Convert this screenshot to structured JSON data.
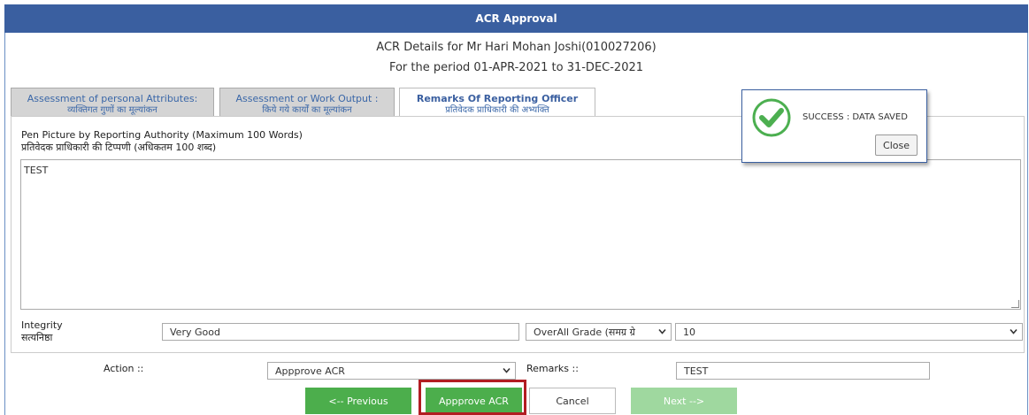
{
  "dialog_title": "ACR Approval",
  "header": {
    "line1": "ACR Details for Mr Hari Mohan Joshi(010027206)",
    "line2": "For the period 01-APR-2021 to 31-DEC-2021"
  },
  "tabs": [
    {
      "label": "Assessment of personal Attributes:",
      "sub": "व्यक्तिगत गुणों का मूल्यांकन",
      "active": false
    },
    {
      "label": "Assessment or Work Output :",
      "sub": "किये गये कार्यों का मूल्यांकन",
      "active": false
    },
    {
      "label": "Remarks Of Reporting Officer",
      "sub": "प्रतिवेदक प्राधिकारी की अभ्यक्ति",
      "active": true
    }
  ],
  "pen_picture": {
    "label_en": "Pen Picture by Reporting Authority (Maximum 100 Words)",
    "label_hi": "प्रतिवेदक प्राधिकारी की टिप्पणी (अधिकतम 100 शब्द)",
    "value": "TEST"
  },
  "integrity": {
    "label_en": "Integrity",
    "label_hi": "सत्यनिष्ठा",
    "value": "Very Good"
  },
  "overall_grade": {
    "select_value": "OverAll Grade (समग्र ग्रे",
    "grade_value": "10"
  },
  "action": {
    "label": "Action ::",
    "value": "Appprove ACR",
    "remarks_label": "Remarks ::",
    "remarks_value": "TEST"
  },
  "buttons": {
    "previous": "<-- Previous",
    "approve": "Appprove ACR",
    "cancel": "Cancel",
    "next": "Next -->"
  },
  "success_dialog": {
    "message": "SUCCESS : DATA SAVED",
    "close_label": "Close",
    "icon": "check-circle-icon"
  },
  "colors": {
    "title_bar": "#3a5fa0",
    "button_green": "#4cae4c",
    "button_disabled": "#9fd89f",
    "highlight": "#b21d22",
    "success_icon": "#4caf50"
  }
}
